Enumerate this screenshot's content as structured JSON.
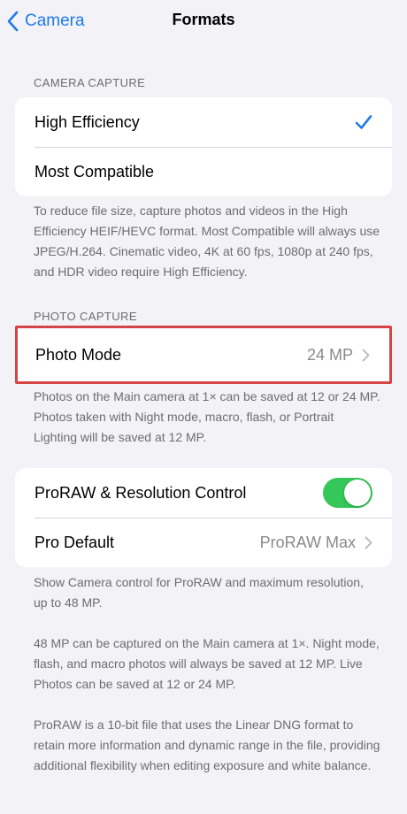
{
  "nav": {
    "back_label": "Camera",
    "title": "Formats",
    "accent": "#1f7be8"
  },
  "camera_capture": {
    "header": "CAMERA CAPTURE",
    "options": [
      {
        "label": "High Efficiency",
        "selected": true
      },
      {
        "label": "Most Compatible",
        "selected": false
      }
    ],
    "footer": "To reduce file size, capture photos and videos in the High Efficiency HEIF/HEVC format. Most Compatible will always use JPEG/H.264. Cinematic video, 4K at 60 fps, 1080p at 240 fps, and HDR video require High Efficiency."
  },
  "photo_capture": {
    "header": "PHOTO CAPTURE",
    "photo_mode": {
      "label": "Photo Mode",
      "value": "24 MP"
    },
    "footer": "Photos on the Main camera at 1× can be saved at 12 or 24 MP. Photos taken with Night mode, macro, flash, or Portrait Lighting will be saved at 12 MP."
  },
  "proraw": {
    "toggle_label": "ProRAW & Resolution Control",
    "toggle_on": true,
    "toggle_color": "#35c759",
    "pro_default": {
      "label": "Pro Default",
      "value": "ProRAW Max"
    },
    "footer_1": "Show Camera control for ProRAW and maximum resolution, up to 48 MP.",
    "footer_2": "48 MP can be captured on the Main camera at 1×. Night mode, flash, and macro photos will always be saved at 12 MP. Live Photos can be saved at 12 or 24 MP.",
    "footer_3": "ProRAW is a 10-bit file that uses the Linear DNG format to retain more information and dynamic range in the file, providing additional flexibility when editing exposure and white balance."
  }
}
